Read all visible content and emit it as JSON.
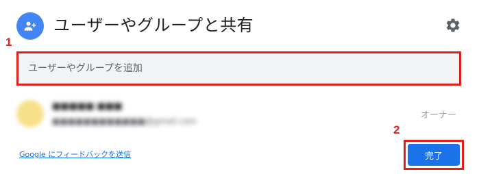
{
  "dialog": {
    "title": "ユーザーやグループと共有"
  },
  "markers": {
    "step1": "1",
    "step2": "2"
  },
  "input": {
    "placeholder": "ユーザーやグループを追加",
    "value": ""
  },
  "person": {
    "name": "■■■■■ ■■■",
    "email": "■■■■■■■■■■■■@gmail.com",
    "role": "オーナー"
  },
  "footer": {
    "feedback_link": "Google にフィードバックを送信",
    "done_label": "完了"
  },
  "colors": {
    "accent_blue": "#1a73e8",
    "share_icon_bg": "#4285f4",
    "highlight_red": "#e0201b",
    "input_bg": "#f1f3f4",
    "avatar_color": "#f7e08a"
  },
  "icons": {
    "header_left": "person-add-icon",
    "header_right": "gear-icon"
  }
}
